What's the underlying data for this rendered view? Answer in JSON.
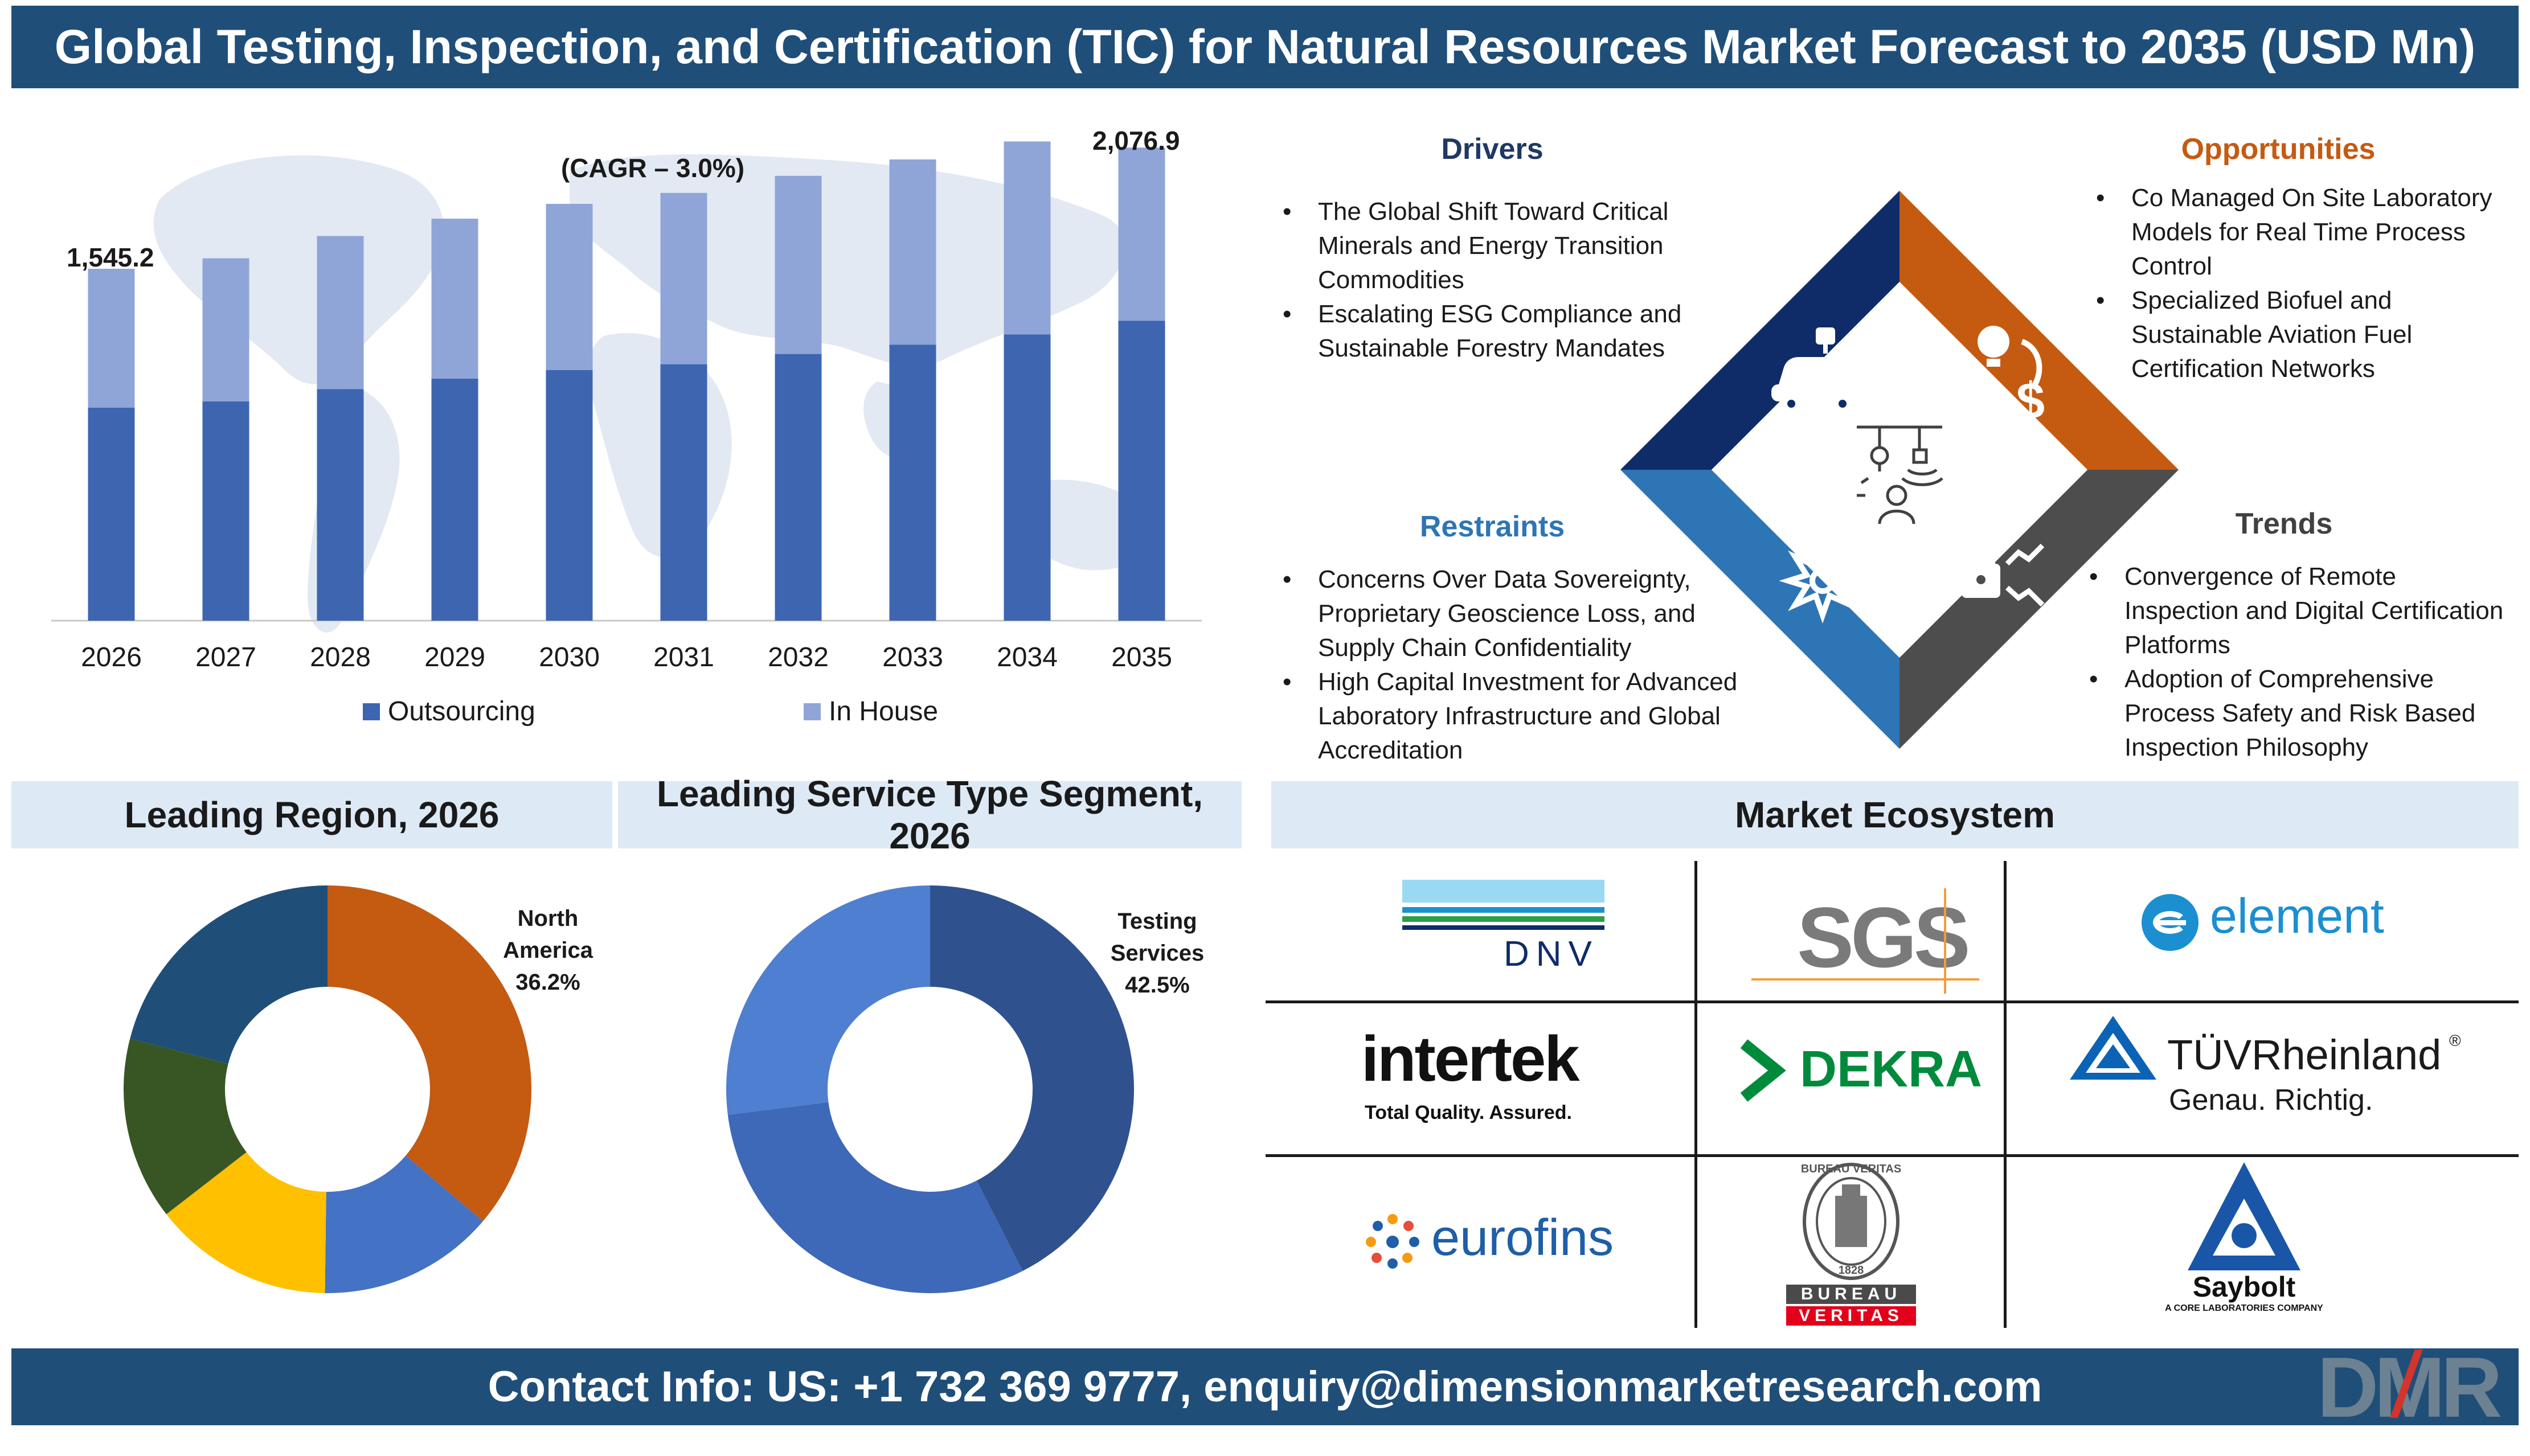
{
  "title": "Global Testing, Inspection, and Certification (TIC) for Natural Resources Market Forecast to 2035 (USD Mn)",
  "chart_data": [
    {
      "type": "bar",
      "stacked": true,
      "categories": [
        "2026",
        "2027",
        "2028",
        "2029",
        "2030",
        "2031",
        "2032",
        "2033",
        "2034",
        "2035"
      ],
      "series": [
        {
          "name": "Outsourcing",
          "values": [
            935,
            963,
            1017,
            1063,
            1100,
            1126,
            1171,
            1212,
            1257,
            1317
          ],
          "color": "#3d65b0"
        },
        {
          "name": "In House",
          "values": [
            610,
            628,
            672,
            702,
            730,
            752,
            782,
            813,
            847,
            760
          ],
          "color": "#8fa5d8"
        }
      ],
      "annotations": [
        {
          "text": "1,545.2",
          "category": "2026"
        },
        {
          "text": "2,076.9",
          "category": "2035"
        },
        {
          "text": "(CAGR – 3.0%)"
        }
      ],
      "ylim": [
        0,
        2300
      ],
      "grid": false,
      "legend": "bottom"
    },
    {
      "type": "pie",
      "title": "Leading Region, 2026",
      "donut": true,
      "slices": [
        {
          "label": "North America",
          "value": 36.2,
          "color": "#c55a11",
          "display": "36.2%"
        },
        {
          "label": "",
          "value": 14.0,
          "color": "#4472c4"
        },
        {
          "label": "",
          "value": 14.3,
          "color": "#ffc000"
        },
        {
          "label": "",
          "value": 14.5,
          "color": "#375623"
        },
        {
          "label": "",
          "value": 21.0,
          "color": "#1f4e79"
        }
      ]
    },
    {
      "type": "pie",
      "title": "Leading Service Type Segment, 2026",
      "donut": true,
      "slices": [
        {
          "label": "Testing Services",
          "value": 42.5,
          "color": "#2f528f",
          "display": "42.5%"
        },
        {
          "label": "",
          "value": 30.5,
          "color": "#3e68b8"
        },
        {
          "label": "",
          "value": 27.0,
          "color": "#4f7fd0"
        }
      ]
    }
  ],
  "drivers": {
    "title": "Drivers",
    "items": [
      "The Global Shift Toward Critical Minerals and Energy Transition Commodities",
      "Escalating ESG Compliance and Sustainable Forestry Mandates"
    ]
  },
  "opportunities": {
    "title": "Opportunities",
    "items": [
      "Co Managed On Site Laboratory Models for Real Time Process Control",
      "Specialized Biofuel and Sustainable Aviation Fuel Certification Networks"
    ]
  },
  "restraints": {
    "title": "Restraints",
    "items": [
      "Concerns Over Data Sovereignty, Proprietary Geoscience Loss, and Supply Chain Confidentiality",
      "High Capital Investment for Advanced Laboratory Infrastructure and Global Accreditation"
    ]
  },
  "trends": {
    "title": "Trends",
    "items": [
      "Convergence of Remote Inspection and Digital Certification Platforms",
      "Adoption of Comprehensive Process Safety and Risk Based Inspection Philosophy"
    ]
  },
  "sections": {
    "region": "Leading Region, 2026",
    "service": "Leading Service Type Segment, 2026",
    "ecosystem": "Market Ecosystem"
  },
  "region_label": {
    "line1": "North",
    "line2": "America",
    "pct": "36.2%"
  },
  "service_label": {
    "line1": "Testing",
    "line2": "Services",
    "pct": "42.5%"
  },
  "logos": {
    "dnv": "DNV",
    "sgs": "SGS",
    "element": "element",
    "intertek": "intertek",
    "intertek_tag": "Total Quality. Assured.",
    "dekra": "DEKRA",
    "tuv": "TÜVRheinland",
    "tuv_reg": "®",
    "tuv_tag": "Genau. Richtig.",
    "eurofins": "eurofins",
    "bv_top": "BUREAU",
    "bv_bottom": "VERITAS",
    "bv_ring": "BUREAU VERITAS",
    "bv_year": "1828",
    "saybolt": "Saybolt",
    "saybolt_tag": "A CORE LABORATORIES COMPANY"
  },
  "footer": "Contact Info: US: +1 732 369 9777, enquiry@dimensionmarketresearch.com",
  "brand": "DMR",
  "colors": {
    "navy": "#1f4e79",
    "drivers_title": "#1f3864",
    "opportunities_title": "#c55a11",
    "restraints_title": "#2e75b6",
    "trends_title": "#404040",
    "quad_navy": "#0f2c69",
    "quad_orange": "#c55a11",
    "quad_blue": "#2e75b6",
    "quad_gray": "#4d4d4d"
  },
  "icons": [
    "car-robot-icon",
    "lightbulb-dollar-icon",
    "gear-flower-icon",
    "lock-trend-icon",
    "center-analysis-icon",
    "dmr-logo-icon"
  ]
}
